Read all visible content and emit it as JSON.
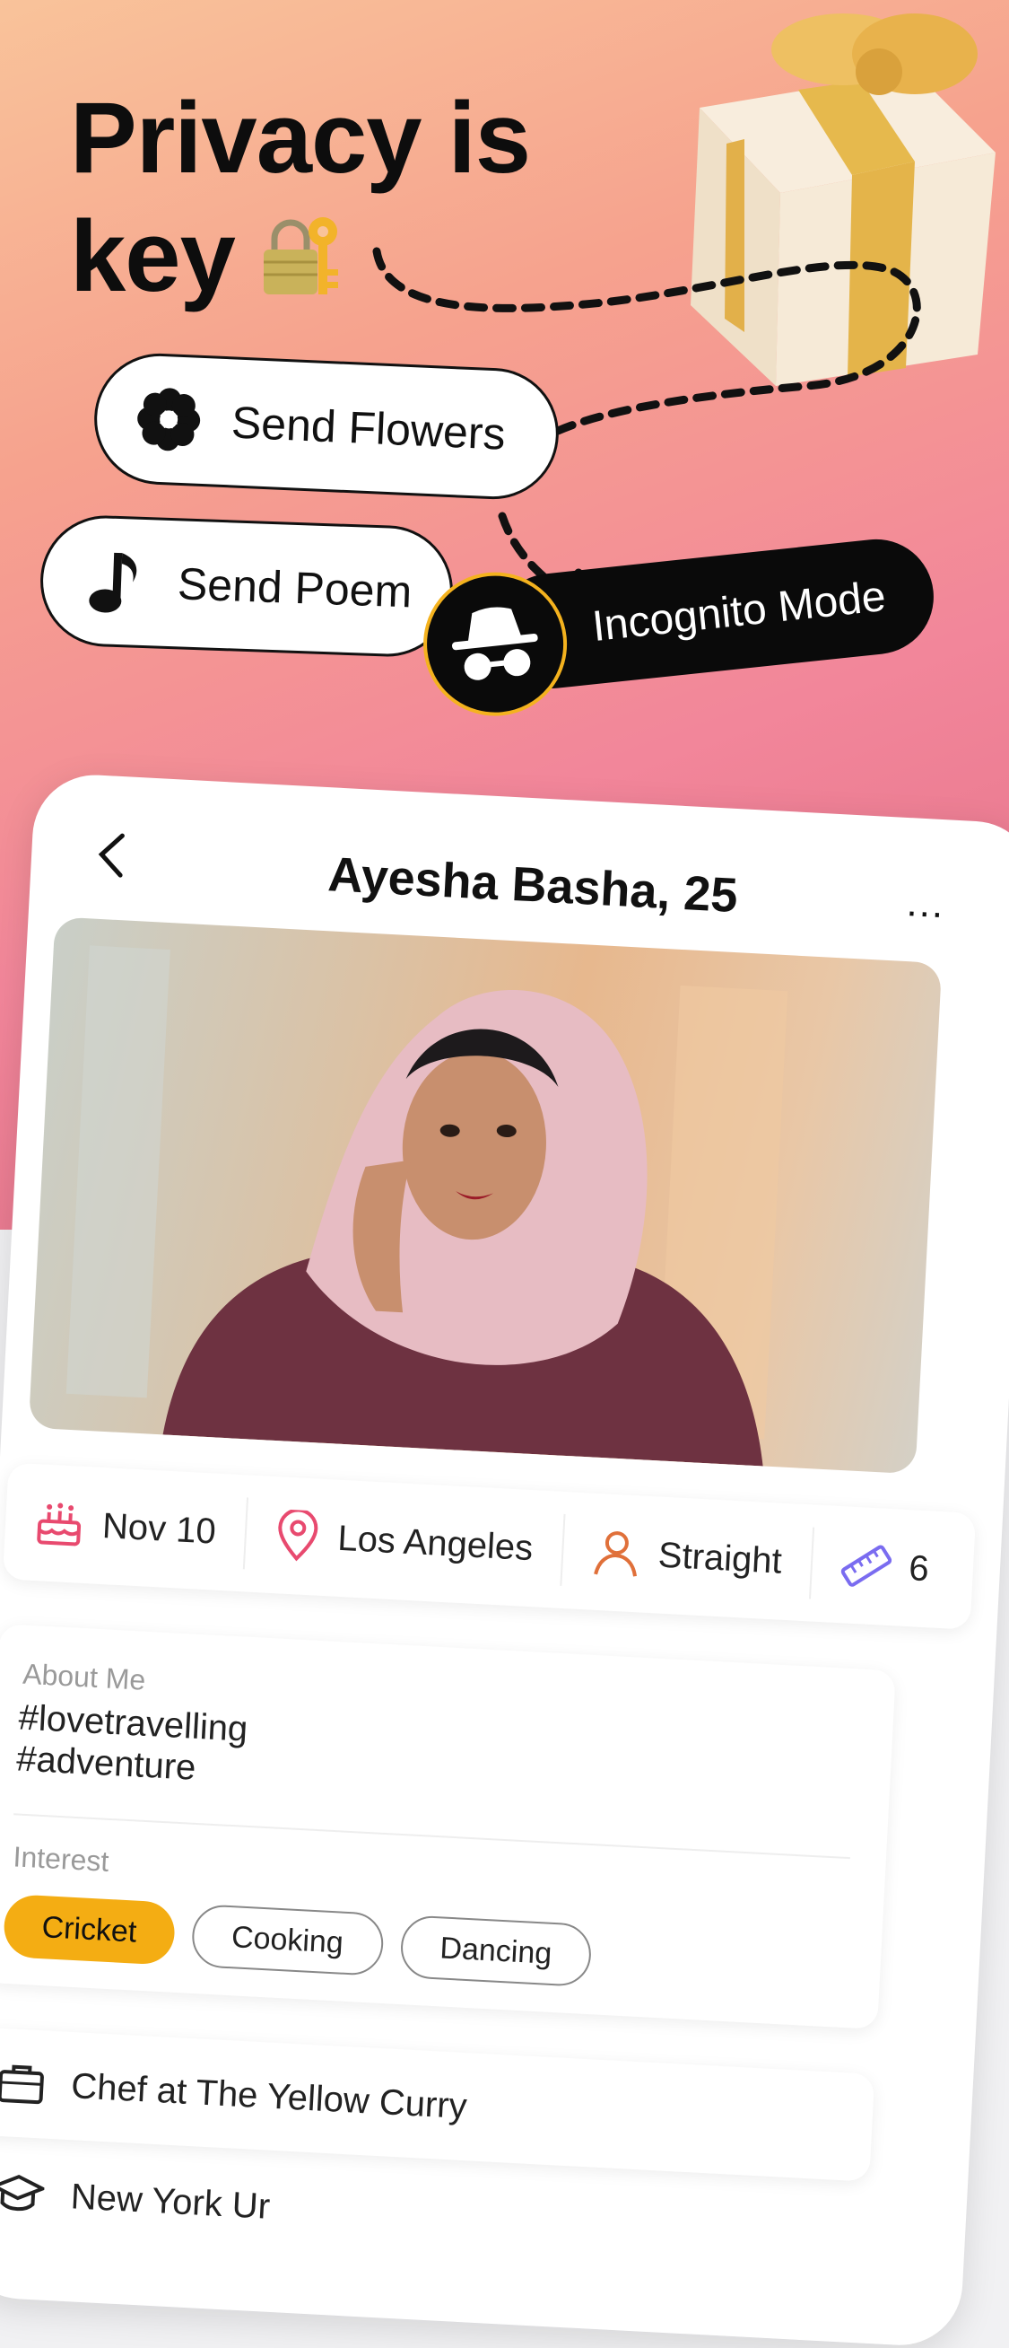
{
  "headline": {
    "line1": "Privacy is",
    "line2": "key"
  },
  "features": {
    "send_flowers": "Send Flowers",
    "send_poem": "Send Poem",
    "incognito": "Incognito Mode"
  },
  "profile": {
    "name_age": "Ayesha Basha, 25",
    "more_label": "...",
    "stats": {
      "birthday": "Nov 10",
      "location": "Los Angeles",
      "orientation": "Straight",
      "height": "6"
    },
    "about_label": "About Me",
    "about_text": "#lovetravelling\n#adventure",
    "interest_label": "Interest",
    "interests": [
      "Cricket",
      "Cooking",
      "Dancing"
    ],
    "job": "Chef at The Yellow Curry",
    "education": "New York Ur"
  },
  "colors": {
    "accent": "#f4ad13",
    "icon_pink": "#e84a6f",
    "icon_orange": "#e0703a",
    "icon_purple": "#7a6cf0",
    "incognito_ring": "#f4b21e"
  },
  "icons": [
    "lock-with-key-icon",
    "flower-icon",
    "music-note-icon",
    "incognito-icon",
    "back-chevron-icon",
    "cake-icon",
    "location-pin-icon",
    "person-icon",
    "ruler-icon",
    "briefcase-icon",
    "graduation-cap-icon"
  ]
}
